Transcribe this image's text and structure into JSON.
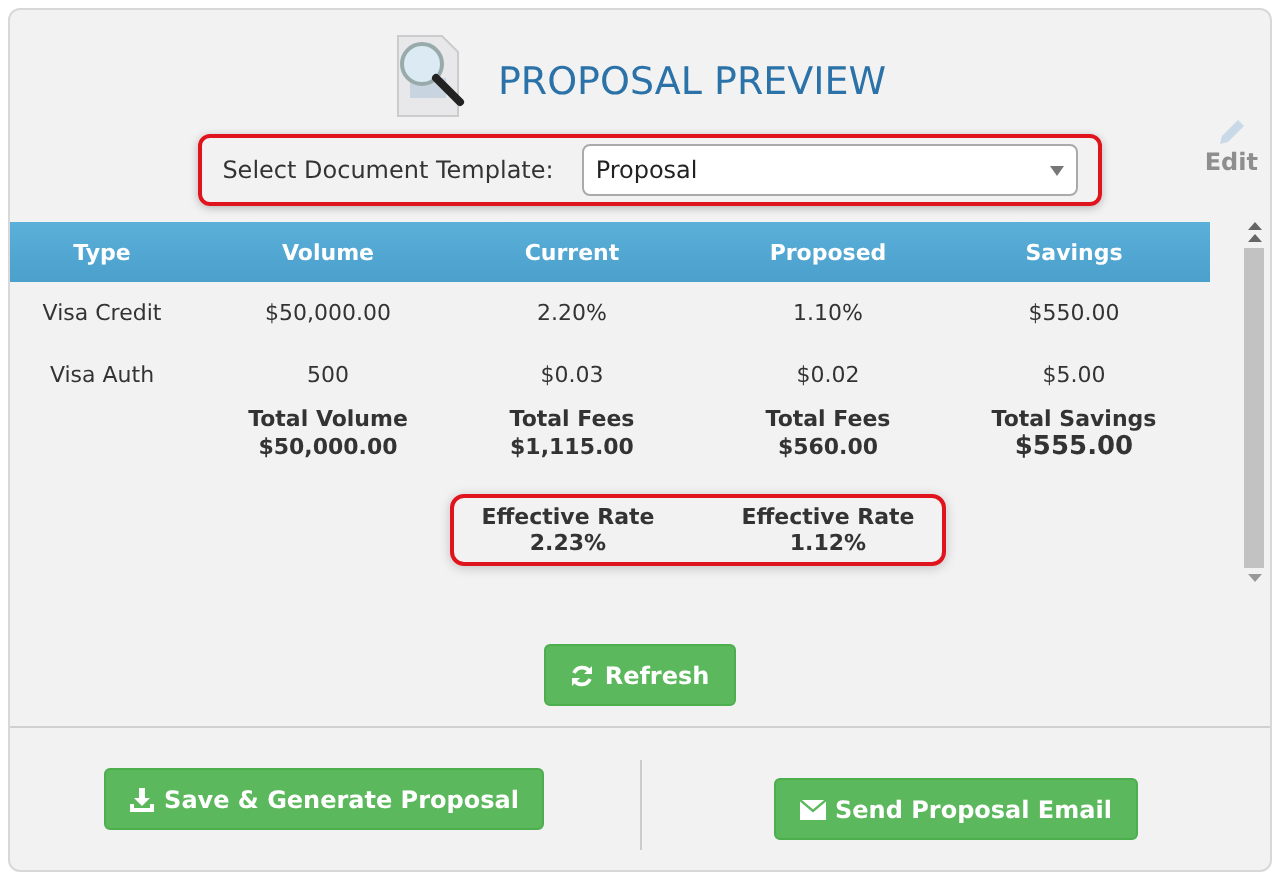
{
  "title": "PROPOSAL PREVIEW",
  "template": {
    "label": "Select Document Template:",
    "value": "Proposal"
  },
  "edit_label": "Edit",
  "table": {
    "columns": [
      "Type",
      "Volume",
      "Current",
      "Proposed",
      "Savings"
    ],
    "rows": [
      [
        "Visa Credit",
        "$50,000.00",
        "2.20%",
        "1.10%",
        "$550.00"
      ],
      [
        "Visa Auth",
        "500",
        "$0.03",
        "$0.02",
        "$5.00"
      ]
    ],
    "totals": [
      {
        "label": "Total Volume",
        "value": "$50,000.00"
      },
      {
        "label": "Total Fees",
        "value": "$1,115.00"
      },
      {
        "label": "Total Fees",
        "value": "$560.00"
      },
      {
        "label": "Total Savings",
        "value": "$555.00"
      }
    ],
    "effective_rates": [
      {
        "label": "Effective Rate",
        "value": "2.23%"
      },
      {
        "label": "Effective Rate",
        "value": "1.12%"
      }
    ]
  },
  "buttons": [
    {
      "kind": "refresh",
      "label": "Refresh"
    },
    {
      "kind": "download",
      "label": "Save & Generate Proposal"
    },
    {
      "kind": "email",
      "label": "Send Proposal Email"
    }
  ]
}
